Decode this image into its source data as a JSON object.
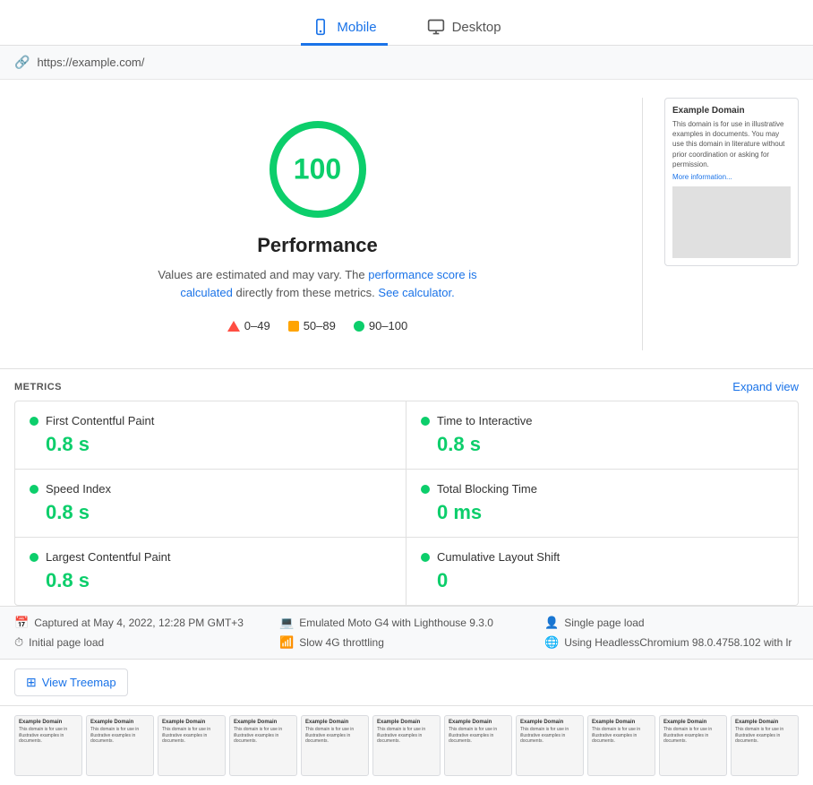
{
  "tabs": [
    {
      "id": "mobile",
      "label": "Mobile",
      "active": true
    },
    {
      "id": "desktop",
      "label": "Desktop",
      "active": false
    }
  ],
  "url": "https://example.com/",
  "score": {
    "value": "100",
    "color": "#0cce6b"
  },
  "performance": {
    "title": "Performance",
    "subtitle_start": "Values are estimated and may vary. The ",
    "subtitle_link1_text": "performance score is calculated",
    "subtitle_link1_href": "#",
    "subtitle_middle": " directly from these metrics. ",
    "subtitle_link2_text": "See calculator.",
    "subtitle_link2_href": "#"
  },
  "legend": {
    "ranges": [
      {
        "id": "red",
        "label": "0–49",
        "type": "triangle"
      },
      {
        "id": "orange",
        "label": "50–89",
        "type": "square"
      },
      {
        "id": "green",
        "label": "90–100",
        "type": "dot",
        "color": "#0cce6b"
      }
    ]
  },
  "preview": {
    "title": "Example Domain",
    "text": "This domain is for use in illustrative examples in documents. You may use this domain in literature without prior coordination or asking for permission.",
    "link": "More information..."
  },
  "metrics": {
    "section_label": "METRICS",
    "expand_label": "Expand view",
    "items": [
      {
        "id": "fcp",
        "name": "First Contentful Paint",
        "value": "0.8 s",
        "color": "#0cce6b"
      },
      {
        "id": "tti",
        "name": "Time to Interactive",
        "value": "0.8 s",
        "color": "#0cce6b"
      },
      {
        "id": "si",
        "name": "Speed Index",
        "value": "0.8 s",
        "color": "#0cce6b"
      },
      {
        "id": "tbt",
        "name": "Total Blocking Time",
        "value": "0 ms",
        "color": "#0cce6b"
      },
      {
        "id": "lcp",
        "name": "Largest Contentful Paint",
        "value": "0.8 s",
        "color": "#0cce6b"
      },
      {
        "id": "cls",
        "name": "Cumulative Layout Shift",
        "value": "0",
        "color": "#0cce6b"
      }
    ]
  },
  "info_bar": {
    "items": [
      {
        "id": "capture-time",
        "icon": "📅",
        "text": "Captured at May 4, 2022, 12:28 PM GMT+3"
      },
      {
        "id": "emulated-device",
        "icon": "💻",
        "text": "Emulated Moto G4 with Lighthouse 9.3.0"
      },
      {
        "id": "single-page",
        "icon": "👤",
        "text": "Single page load"
      },
      {
        "id": "initial-load",
        "icon": "⏱",
        "text": "Initial page load"
      },
      {
        "id": "throttling",
        "icon": "📶",
        "text": "Slow 4G throttling"
      },
      {
        "id": "browser",
        "icon": "🌐",
        "text": "Using HeadlessChromium 98.0.4758.102 with lr"
      }
    ]
  },
  "treemap": {
    "button_label": "View Treemap"
  },
  "filmstrip": {
    "thumbnails": [
      {
        "title": "Example Domain",
        "text": "This domain is for use in illustrative examples in documents."
      },
      {
        "title": "Example Domain",
        "text": "This domain is for use in illustrative examples in documents."
      },
      {
        "title": "Example Domain",
        "text": "This domain is for use in illustrative examples in documents."
      },
      {
        "title": "Example Domain",
        "text": "This domain is for use in illustrative examples in documents."
      },
      {
        "title": "Example Domain",
        "text": "This domain is for use in illustrative examples in documents."
      },
      {
        "title": "Example Domain",
        "text": "This domain is for use in illustrative examples in documents."
      },
      {
        "title": "Example Domain",
        "text": "This domain is for use in illustrative examples in documents."
      },
      {
        "title": "Example Domain",
        "text": "This domain is for use in illustrative examples in documents."
      },
      {
        "title": "Example Domain",
        "text": "This domain is for use in illustrative examples in documents."
      },
      {
        "title": "Example Domain",
        "text": "This domain is for use in illustrative examples in documents."
      },
      {
        "title": "Example Domain",
        "text": "This domain is for use in illustrative examples in documents."
      }
    ]
  }
}
